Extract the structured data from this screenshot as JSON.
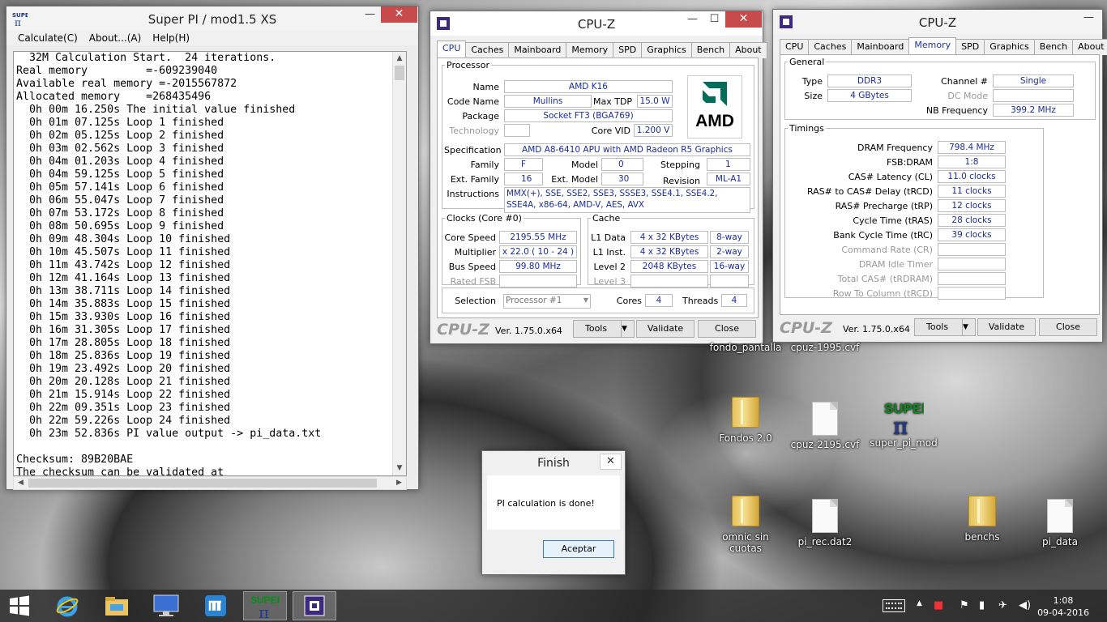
{
  "superpi": {
    "title": "Super PI / mod1.5 XS",
    "menu": [
      "Calculate(C)",
      "About...(A)",
      "Help(H)"
    ],
    "lines": [
      "  32M Calculation Start.  24 iterations.",
      "Real memory         =-609239040",
      "Available real memory =-2015567872",
      "Allocated memory    =268435496",
      "  0h 00m 16.250s The initial value finished",
      "  0h 01m 07.125s Loop 1 finished",
      "  0h 02m 05.125s Loop 2 finished",
      "  0h 03m 02.562s Loop 3 finished",
      "  0h 04m 01.203s Loop 4 finished",
      "  0h 04m 59.125s Loop 5 finished",
      "  0h 05m 57.141s Loop 6 finished",
      "  0h 06m 55.047s Loop 7 finished",
      "  0h 07m 53.172s Loop 8 finished",
      "  0h 08m 50.695s Loop 9 finished",
      "  0h 09m 48.304s Loop 10 finished",
      "  0h 10m 45.507s Loop 11 finished",
      "  0h 11m 43.742s Loop 12 finished",
      "  0h 12m 41.164s Loop 13 finished",
      "  0h 13m 38.711s Loop 14 finished",
      "  0h 14m 35.883s Loop 15 finished",
      "  0h 15m 33.930s Loop 16 finished",
      "  0h 16m 31.305s Loop 17 finished",
      "  0h 17m 28.805s Loop 18 finished",
      "  0h 18m 25.836s Loop 19 finished",
      "  0h 19m 23.492s Loop 20 finished",
      "  0h 20m 20.128s Loop 21 finished",
      "  0h 21m 15.914s Loop 22 finished",
      "  0h 22m 09.351s Loop 23 finished",
      "  0h 22m 59.226s Loop 24 finished",
      "  0h 23m 52.836s PI value output -> pi_data.txt",
      "",
      "Checksum: 89B20BAE",
      "The checksum can be validated at"
    ]
  },
  "cpuz1": {
    "title": "CPU-Z",
    "tabs": [
      "CPU",
      "Caches",
      "Mainboard",
      "Memory",
      "SPD",
      "Graphics",
      "Bench",
      "About"
    ],
    "processor_legend": "Processor",
    "name_label": "Name",
    "name": "AMD K16",
    "codename_label": "Code Name",
    "codename": "Mullins",
    "maxtdp_label": "Max TDP",
    "maxtdp": "15.0 W",
    "package_label": "Package",
    "package": "Socket FT3 (BGA769)",
    "technology_label": "Technology",
    "corevid_label": "Core VID",
    "corevid": "1.200 V",
    "spec_label": "Specification",
    "spec": "AMD A8-6410 APU with AMD Radeon R5 Graphics",
    "family_label": "Family",
    "family": "F",
    "model_label": "Model",
    "model": "0",
    "stepping_label": "Stepping",
    "stepping": "1",
    "extfamily_label": "Ext. Family",
    "extfamily": "16",
    "extmodel_label": "Ext. Model",
    "extmodel": "30",
    "revision_label": "Revision",
    "revision": "ML-A1",
    "instr_label": "Instructions",
    "instr": "MMX(+), SSE, SSE2, SSE3, SSSE3, SSE4.1, SSE4.2, SSE4A, x86-64, AMD-V, AES, AVX",
    "logo": "AMD",
    "clocks_legend": "Clocks (Core #0)",
    "corespeed_label": "Core Speed",
    "corespeed": "2195.55 MHz",
    "multiplier_label": "Multiplier",
    "multiplier": "x 22.0 ( 10 - 24 )",
    "busspeed_label": "Bus Speed",
    "busspeed": "99.80 MHz",
    "ratedfsb_label": "Rated FSB",
    "cache_legend": "Cache",
    "l1d_label": "L1 Data",
    "l1d": "4 x 32 KBytes",
    "l1d_way": "8-way",
    "l1i_label": "L1 Inst.",
    "l1i": "4 x 32 KBytes",
    "l1i_way": "2-way",
    "l2_label": "Level 2",
    "l2": "2048 KBytes",
    "l2_way": "16-way",
    "l3_label": "Level 3",
    "selection_label": "Selection",
    "selection": "Processor #1",
    "cores_label": "Cores",
    "cores": "4",
    "threads_label": "Threads",
    "threads": "4",
    "brand": "CPU-Z",
    "version": "Ver. 1.75.0.x64",
    "tools": "Tools",
    "validate": "Validate",
    "close": "Close"
  },
  "cpuz2": {
    "title": "CPU-Z",
    "tabs": [
      "CPU",
      "Caches",
      "Mainboard",
      "Memory",
      "SPD",
      "Graphics",
      "Bench",
      "About"
    ],
    "general_legend": "General",
    "type_label": "Type",
    "type": "DDR3",
    "channel_label": "Channel #",
    "channel": "Single",
    "size_label": "Size",
    "size": "4 GBytes",
    "dcmode_label": "DC Mode",
    "nbfreq_label": "NB Frequency",
    "nbfreq": "399.2 MHz",
    "timings_legend": "Timings",
    "timings": [
      {
        "label": "DRAM Frequency",
        "value": "798.4 MHz",
        "enabled": true
      },
      {
        "label": "FSB:DRAM",
        "value": "1:8",
        "enabled": true
      },
      {
        "label": "CAS# Latency (CL)",
        "value": "11.0 clocks",
        "enabled": true
      },
      {
        "label": "RAS# to CAS# Delay (tRCD)",
        "value": "11 clocks",
        "enabled": true
      },
      {
        "label": "RAS# Precharge (tRP)",
        "value": "12 clocks",
        "enabled": true
      },
      {
        "label": "Cycle Time (tRAS)",
        "value": "28 clocks",
        "enabled": true
      },
      {
        "label": "Bank Cycle Time (tRC)",
        "value": "39 clocks",
        "enabled": true
      },
      {
        "label": "Command Rate (CR)",
        "value": "",
        "enabled": false
      },
      {
        "label": "DRAM Idle Timer",
        "value": "",
        "enabled": false
      },
      {
        "label": "Total CAS# (tRDRAM)",
        "value": "",
        "enabled": false
      },
      {
        "label": "Row To Column (tRCD)",
        "value": "",
        "enabled": false
      }
    ],
    "brand": "CPU-Z",
    "version": "Ver. 1.75.0.x64",
    "tools": "Tools",
    "validate": "Validate",
    "close": "Close"
  },
  "finish": {
    "title": "Finish",
    "message": "PI calculation is done!",
    "ok": "Aceptar"
  },
  "desktop": [
    "fondo_pantalla",
    "cpuz-1995.cvf",
    "Fondos 2.0",
    "cpuz-2195.cvf",
    "super_pi_mod",
    "omnic sin cuotas",
    "pi_rec.dat2",
    "benchs",
    "pi_data"
  ],
  "taskbar": {
    "time": "1:08",
    "date": "09-04-2016"
  }
}
